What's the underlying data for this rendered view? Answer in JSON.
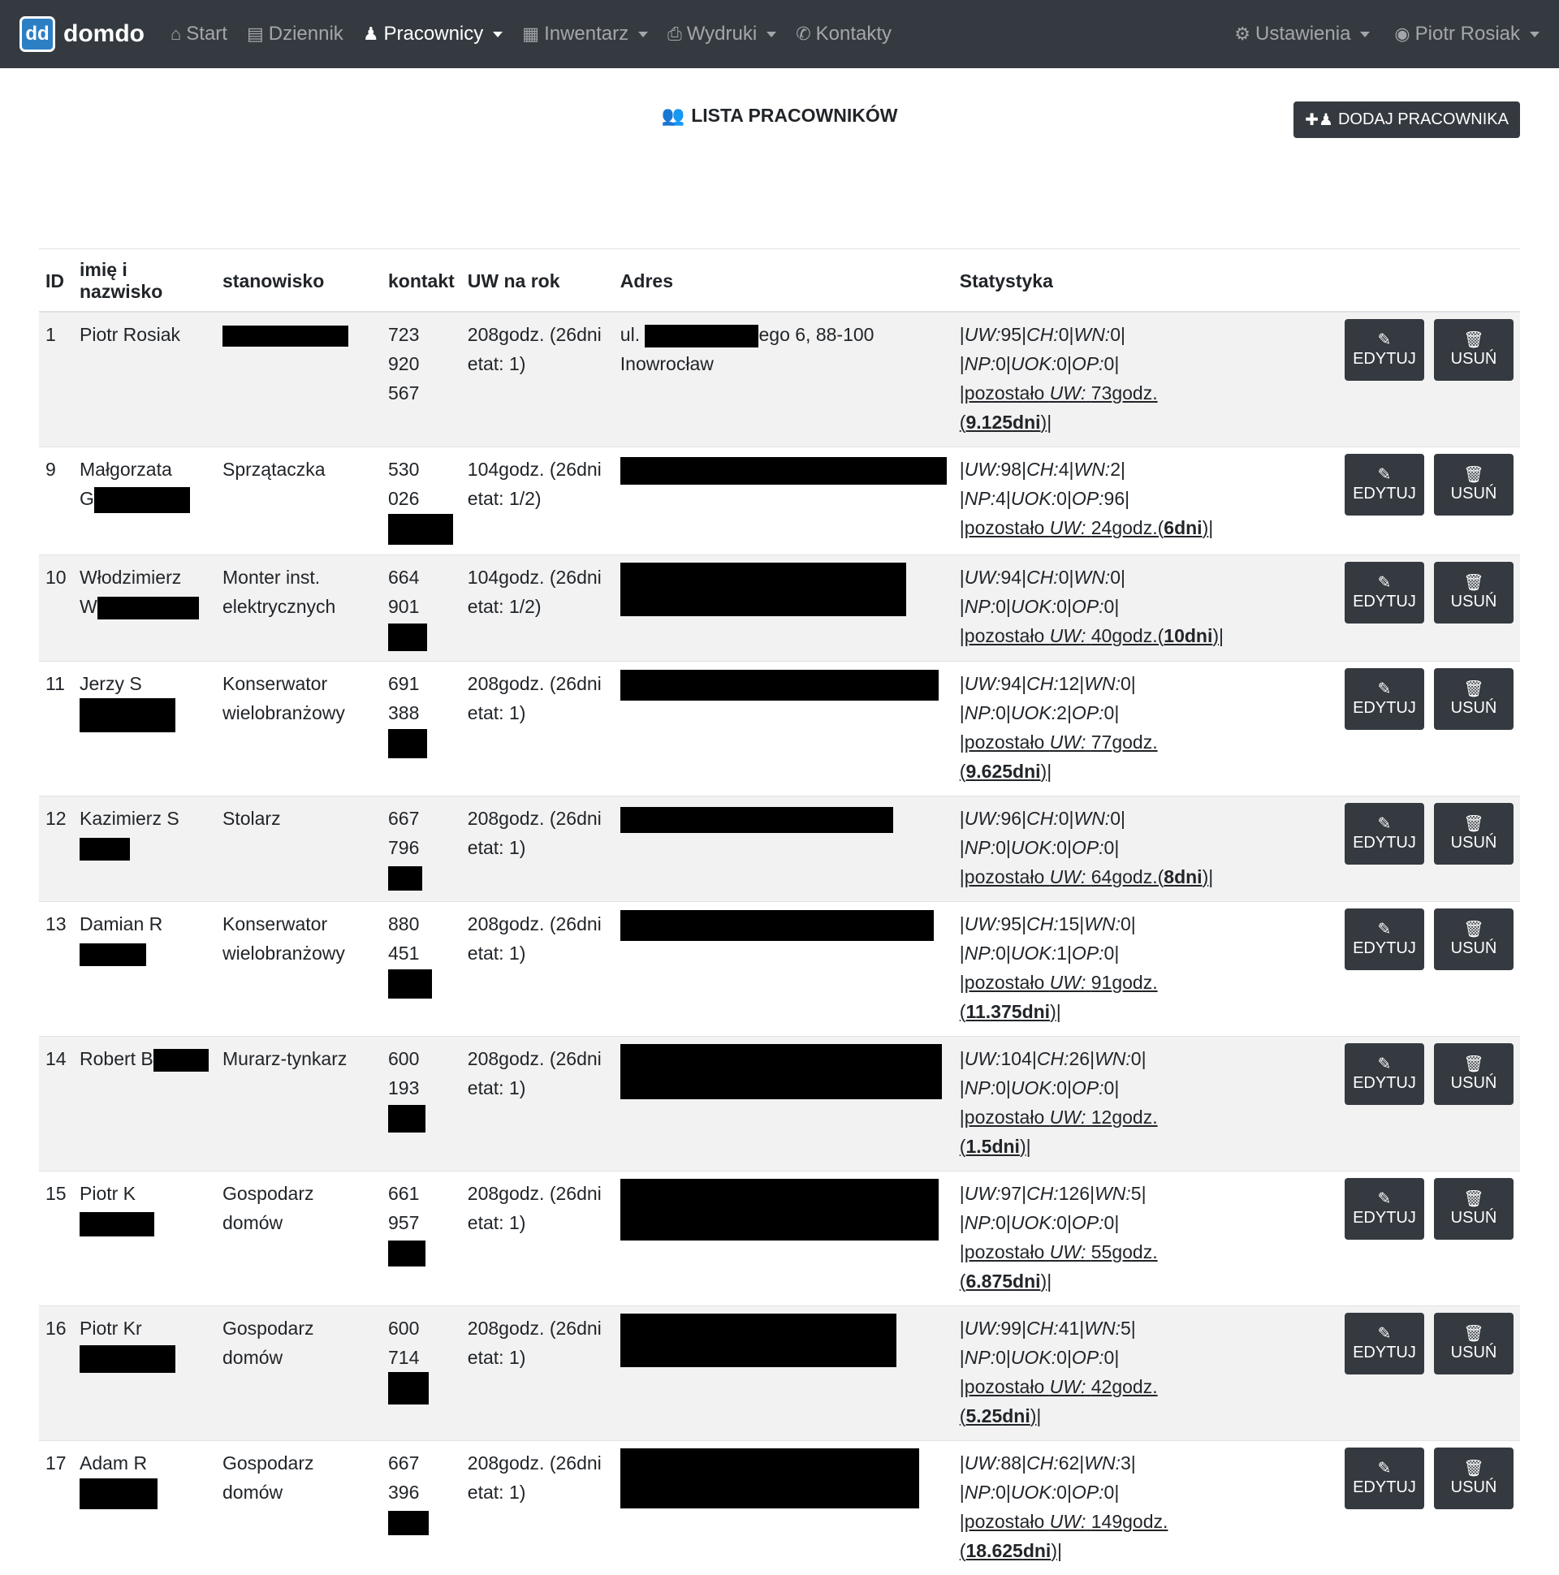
{
  "brand": {
    "logo": "dd",
    "name": "domdo"
  },
  "nav": [
    {
      "label": "Start",
      "icon": "home-icon",
      "glyph": "⌂",
      "caret": false,
      "active": false
    },
    {
      "label": "Dziennik",
      "icon": "book-icon",
      "glyph": "▤",
      "caret": false,
      "active": false
    },
    {
      "label": "Pracownicy",
      "icon": "person-icon",
      "glyph": "♟",
      "caret": true,
      "active": true
    },
    {
      "label": "Inwentarz",
      "icon": "building-icon",
      "glyph": "▦",
      "caret": true,
      "active": false
    },
    {
      "label": "Wydruki",
      "icon": "printer-icon",
      "glyph": "⎙",
      "caret": true,
      "active": false
    },
    {
      "label": "Kontakty",
      "icon": "phone-icon",
      "glyph": "✆",
      "caret": false,
      "active": false
    }
  ],
  "nav_right": [
    {
      "label": "Ustawienia",
      "icon": "gear-icon",
      "glyph": "⚙"
    },
    {
      "label": "Piotr Rosiak",
      "icon": "user-circle-icon",
      "glyph": "◉"
    }
  ],
  "page": {
    "title": "LISTA PRACOWNIKÓW",
    "add_button": "DODAJ PRACOWNIKA"
  },
  "columns": [
    "ID",
    "imię i nazwisko",
    "stanowisko",
    "kontakt",
    "UW na rok",
    "Adres",
    "Statystyka"
  ],
  "buttons": {
    "edit": "EDYTUJ",
    "delete": "USUŃ"
  },
  "rows": [
    {
      "id": "1",
      "name": "Piotr Rosiak",
      "position": "",
      "phone": "723 920",
      "phone2": "567",
      "uw1": "208godz. (26dni",
      "uw2": "etat: 1)",
      "addr": "ego 6, 88-100",
      "addr_pre": "ul.",
      "addr2": "Inowrocław",
      "stat": {
        "UW": "95",
        "CH": "0",
        "WN": "0",
        "NP": "0",
        "UOK": "0",
        "OP": "0",
        "rem_h": "73",
        "rem_d": "9.125"
      }
    },
    {
      "id": "9",
      "name": "Małgorzata",
      "name2": "G",
      "position": "Sprzątaczka",
      "phone": "530 026",
      "uw1": "104godz. (26dni",
      "uw2": "etat: 1/2)",
      "stat": {
        "UW": "98",
        "CH": "4",
        "WN": "2",
        "NP": "4",
        "UOK": "0",
        "OP": "96",
        "rem_h": "24",
        "rem_d": "6"
      }
    },
    {
      "id": "10",
      "name": "Włodzimierz",
      "name2": "W",
      "position": "Monter inst.",
      "position2": "elektrycznych",
      "phone": "664 901",
      "uw1": "104godz. (26dni",
      "uw2": "etat: 1/2)",
      "stat": {
        "UW": "94",
        "CH": "0",
        "WN": "0",
        "NP": "0",
        "UOK": "0",
        "OP": "0",
        "rem_h": "40",
        "rem_d": "10"
      }
    },
    {
      "id": "11",
      "name": "Jerzy S",
      "position": "Konserwator",
      "position2": "wielobranżowy",
      "phone": "691 388",
      "uw1": "208godz. (26dni",
      "uw2": "etat: 1)",
      "stat": {
        "UW": "94",
        "CH": "12",
        "WN": "0",
        "NP": "0",
        "UOK": "2",
        "OP": "0",
        "rem_h": "77",
        "rem_d": "9.625"
      }
    },
    {
      "id": "12",
      "name": "Kazimierz S",
      "position": "Stolarz",
      "phone": "667 796",
      "uw1": "208godz. (26dni",
      "uw2": "etat: 1)",
      "stat": {
        "UW": "96",
        "CH": "0",
        "WN": "0",
        "NP": "0",
        "UOK": "0",
        "OP": "0",
        "rem_h": "64",
        "rem_d": "8"
      }
    },
    {
      "id": "13",
      "name": "Damian R",
      "position": "Konserwator",
      "position2": "wielobranżowy",
      "phone": "880 451",
      "uw1": "208godz. (26dni",
      "uw2": "etat: 1)",
      "stat": {
        "UW": "95",
        "CH": "15",
        "WN": "0",
        "NP": "0",
        "UOK": "1",
        "OP": "0",
        "rem_h": "91",
        "rem_d": "11.375"
      }
    },
    {
      "id": "14",
      "name": "Robert B",
      "position": "Murarz-tynkarz",
      "phone": "600 193",
      "uw1": "208godz. (26dni",
      "uw2": "etat: 1)",
      "stat": {
        "UW": "104",
        "CH": "26",
        "WN": "0",
        "NP": "0",
        "UOK": "0",
        "OP": "0",
        "rem_h": "12",
        "rem_d": "1.5"
      }
    },
    {
      "id": "15",
      "name": "Piotr K",
      "position": "Gospodarz domów",
      "phone": "661 957",
      "uw1": "208godz. (26dni",
      "uw2": "etat: 1)",
      "stat": {
        "UW": "97",
        "CH": "126",
        "WN": "5",
        "NP": "0",
        "UOK": "0",
        "OP": "0",
        "rem_h": "55",
        "rem_d": "6.875"
      }
    },
    {
      "id": "16",
      "name": "Piotr Kr",
      "position": "Gospodarz domów",
      "phone": "600 714",
      "uw1": "208godz. (26dni",
      "uw2": "etat: 1)",
      "stat": {
        "UW": "99",
        "CH": "41",
        "WN": "5",
        "NP": "0",
        "UOK": "0",
        "OP": "0",
        "rem_h": "42",
        "rem_d": "5.25"
      }
    },
    {
      "id": "17",
      "name": "Adam R",
      "position": "Gospodarz domów",
      "phone": "667 396",
      "uw1": "208godz. (26dni",
      "uw2": "etat: 1)",
      "stat": {
        "UW": "88",
        "CH": "62",
        "WN": "3",
        "NP": "0",
        "UOK": "0",
        "OP": "0",
        "rem_h": "149",
        "rem_d": "18.625"
      }
    }
  ]
}
